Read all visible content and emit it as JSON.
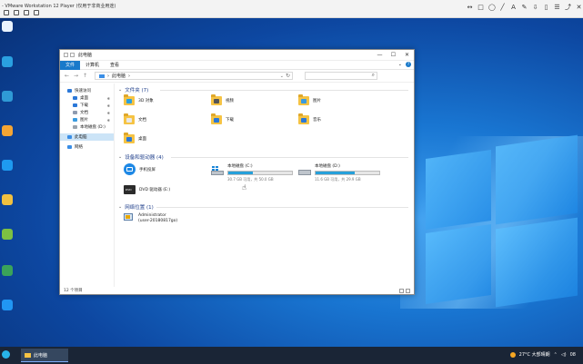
{
  "host": {
    "title": "- VMware Workstation 12 Player (仅用于非商业用途)",
    "annotation_tools": [
      "↔",
      "□",
      "◯",
      "╱",
      "A",
      "✎",
      "⇩",
      "▯",
      "☰",
      "⤴",
      "✕",
      "✔"
    ]
  },
  "desktop": {
    "icons": [
      {
        "label": "",
        "color": "#e9f3ff"
      },
      {
        "label": "",
        "color": "#2aa0e0"
      },
      {
        "label": "",
        "color": "#2f9ad6"
      },
      {
        "label": "",
        "color": "#f4a534"
      },
      {
        "label": "",
        "color": "#1e9af0"
      },
      {
        "label": "",
        "color": "#f0c040"
      },
      {
        "label": "",
        "color": "#7cc043"
      },
      {
        "label": "",
        "color": "#3aa35a"
      },
      {
        "label": "",
        "color": "#2196f3"
      }
    ]
  },
  "taskbar": {
    "app_label": "此电脑",
    "weather": "27°C 大部晴朗",
    "time": "08"
  },
  "explorer": {
    "title": "此电脑",
    "ribbon_tabs": [
      "文件",
      "计算机",
      "查看"
    ],
    "window_controls": [
      "—",
      "☐",
      "✕"
    ],
    "nav": [
      "←",
      "→",
      "↑"
    ],
    "address": {
      "path": "此电脑",
      "separator": "›"
    },
    "search": {
      "placeholder": ""
    },
    "sidebar": [
      {
        "label": "快速访问",
        "color": "#2b78d8",
        "sub": false,
        "pin": false,
        "sel": false
      },
      {
        "label": "桌面",
        "color": "#2b78d8",
        "sub": true,
        "pin": true,
        "sel": false
      },
      {
        "label": "下载",
        "color": "#2b78d8",
        "sub": true,
        "pin": true,
        "sel": false
      },
      {
        "label": "文档",
        "color": "#8f9bb0",
        "sub": true,
        "pin": true,
        "sel": false
      },
      {
        "label": "图片",
        "color": "#3a9be0",
        "sub": true,
        "pin": true,
        "sel": false
      },
      {
        "label": "本地磁盘 (D:)",
        "color": "#9aa3ad",
        "sub": true,
        "pin": false,
        "sel": false
      },
      {
        "label": "此电脑",
        "color": "#3a8ee6",
        "sub": false,
        "pin": false,
        "sel": true
      },
      {
        "label": "网络",
        "color": "#3a8ee6",
        "sub": false,
        "pin": false,
        "sel": false
      }
    ],
    "sections": {
      "folders": "文件夹 (7)",
      "devices": "设备和驱动器 (4)",
      "network": "网络位置 (1)"
    },
    "folders": [
      {
        "label": "3D 对象",
        "overlay": "#2aa0e0"
      },
      {
        "label": "视频",
        "overlay": "#555555"
      },
      {
        "label": "图片",
        "overlay": "#3a9be0"
      },
      {
        "label": "文档",
        "overlay": "#e8e8e8"
      },
      {
        "label": "下载",
        "overlay": "#2b78d8"
      },
      {
        "label": "音乐",
        "overlay": "#2b78d8"
      },
      {
        "label": "桌面",
        "overlay": "#2b78d8"
      }
    ],
    "devices": {
      "media": {
        "label": "手机投屏"
      },
      "dvd": {
        "label": "DVD 驱动器 (E:)"
      },
      "c": {
        "label": "本地磁盘 (C:)",
        "free": "30.7 GB 可用，共 50.0 GB",
        "fill": 0.39
      },
      "d": {
        "label": "本地磁盘 (D:)",
        "free": "11.6 GB 可用，共 29.9 GB",
        "fill": 0.61
      }
    },
    "network_item": {
      "line1": "Administrator",
      "line2": "(user-20180817go)"
    },
    "status": "12 个项目"
  }
}
